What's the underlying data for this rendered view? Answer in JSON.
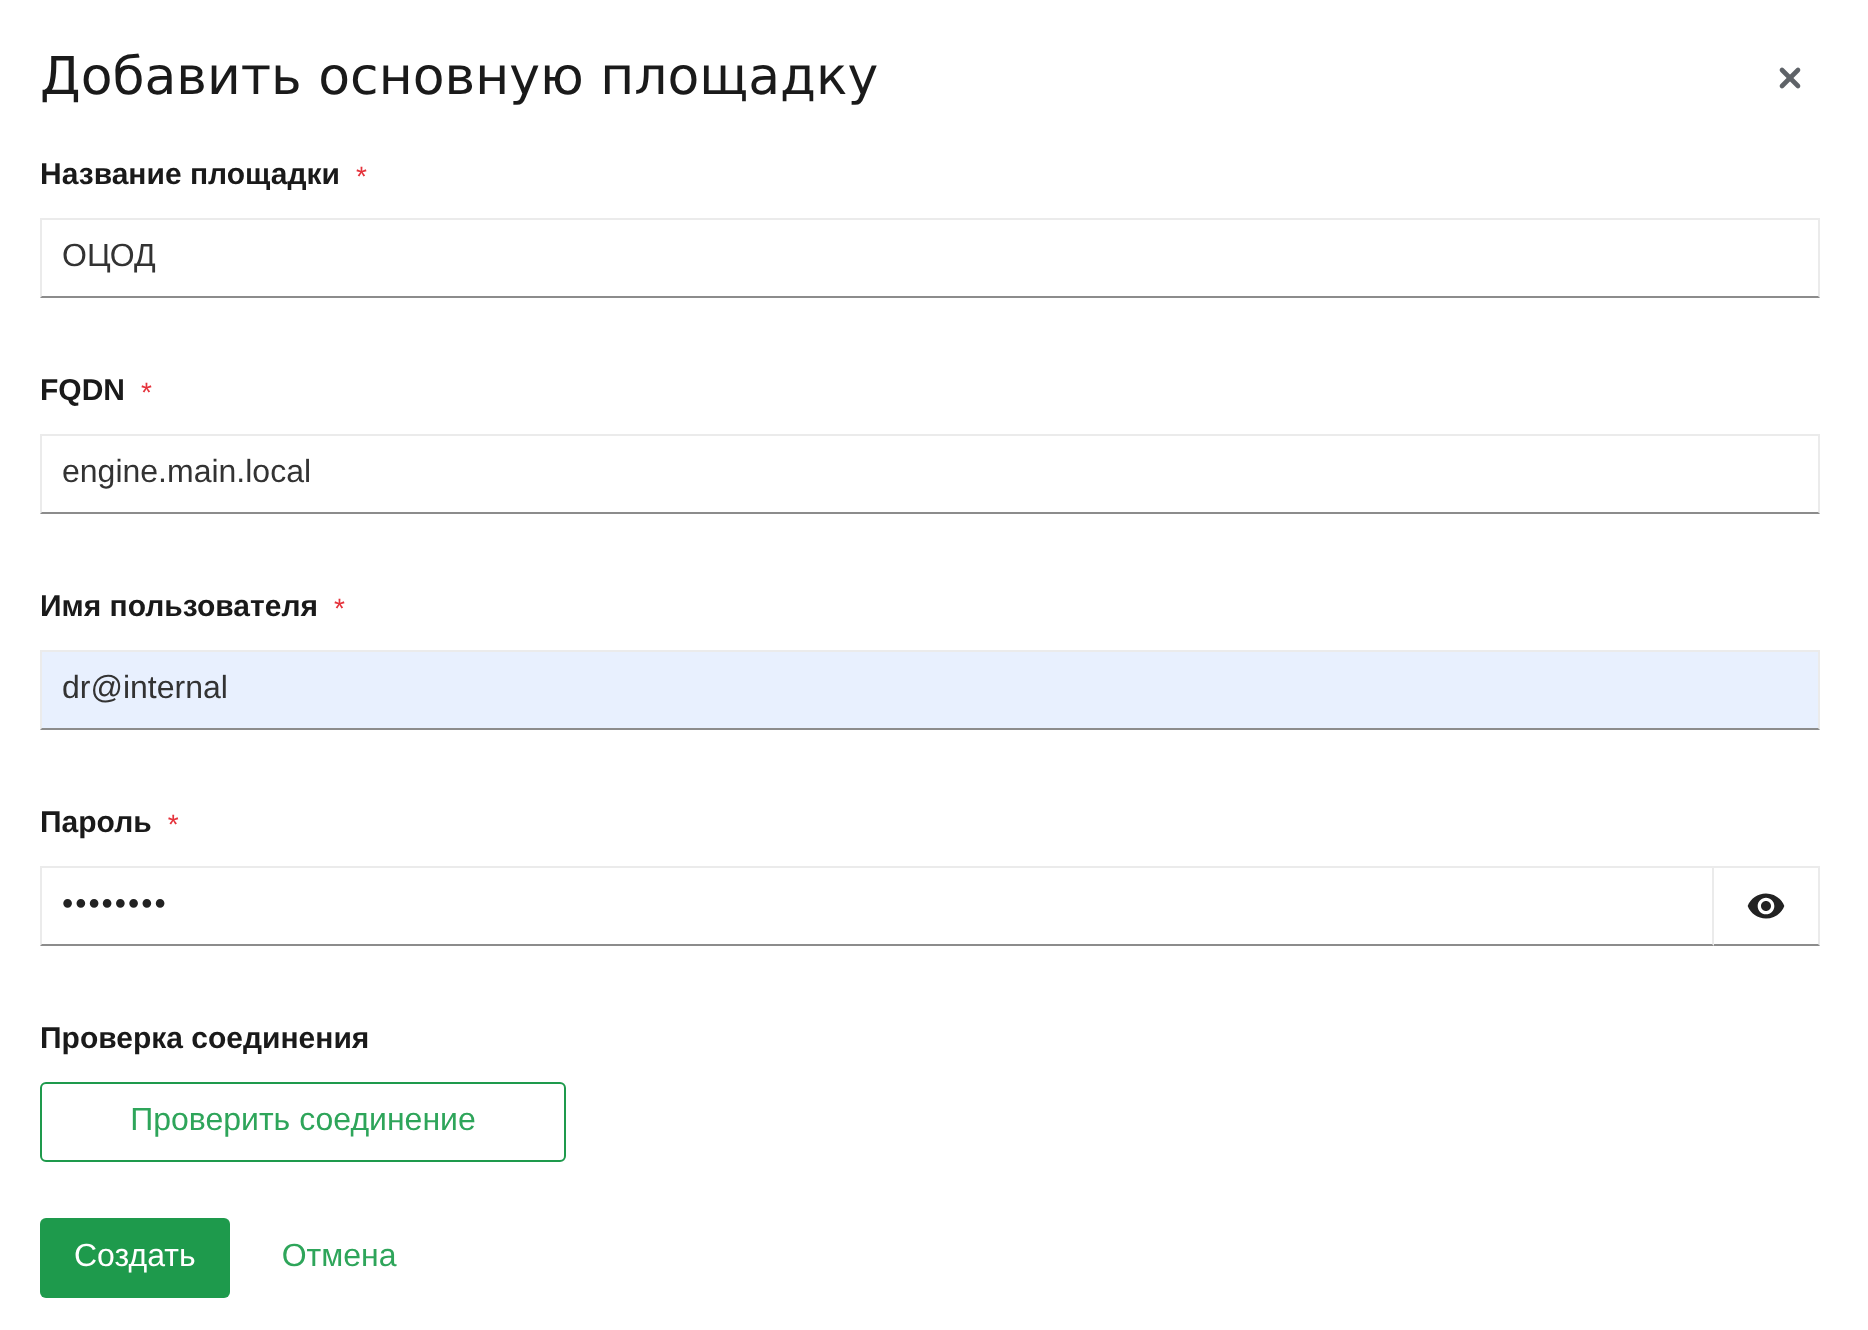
{
  "dialog": {
    "title": "Добавить основную площадку"
  },
  "fields": [
    {
      "kind": "text",
      "label": "Название площадки",
      "required_mark": "*",
      "value": "ОЦОД",
      "autofilled": false
    },
    {
      "kind": "text",
      "label": "FQDN",
      "required_mark": "*",
      "value": "engine.main.local",
      "autofilled": false
    },
    {
      "kind": "text",
      "label": "Имя пользователя",
      "required_mark": "*",
      "value": "dr@internal",
      "autofilled": true
    },
    {
      "kind": "password",
      "label": "Пароль",
      "required_mark": "*",
      "value": "••••••••",
      "autofilled": false
    }
  ],
  "connection_check": {
    "label": "Проверка соединения",
    "button": "Проверить соединение"
  },
  "actions": [
    {
      "kind": "primary",
      "label": "Создать"
    },
    {
      "kind": "link",
      "label": "Отмена"
    }
  ]
}
